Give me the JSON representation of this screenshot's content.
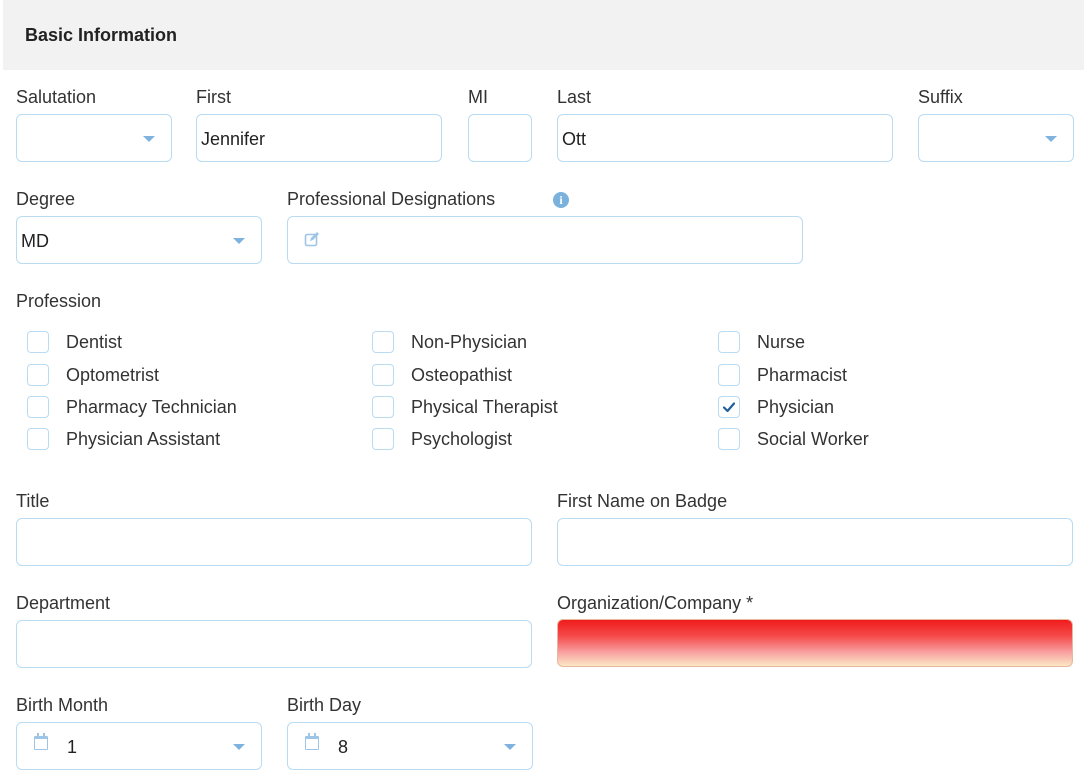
{
  "section": {
    "title": "Basic Information"
  },
  "name": {
    "salutation": {
      "label": "Salutation",
      "value": ""
    },
    "first": {
      "label": "First",
      "value": "Jennifer"
    },
    "mi": {
      "label": "MI",
      "value": ""
    },
    "last": {
      "label": "Last",
      "value": "Ott"
    },
    "suffix": {
      "label": "Suffix",
      "value": ""
    }
  },
  "degree": {
    "label": "Degree",
    "value": "MD"
  },
  "designations": {
    "label": "Professional Designations",
    "info_icon": "info-icon",
    "edit_icon": "edit-icon"
  },
  "profession": {
    "label": "Profession",
    "options": [
      {
        "label": "Dentist",
        "checked": false
      },
      {
        "label": "Non-Physician",
        "checked": false
      },
      {
        "label": "Nurse",
        "checked": false
      },
      {
        "label": "Optometrist",
        "checked": false
      },
      {
        "label": "Osteopathist",
        "checked": false
      },
      {
        "label": "Pharmacist",
        "checked": false
      },
      {
        "label": "Pharmacy Technician",
        "checked": false
      },
      {
        "label": "Physical Therapist",
        "checked": false
      },
      {
        "label": "Physician",
        "checked": true
      },
      {
        "label": "Physician Assistant",
        "checked": false
      },
      {
        "label": "Psychologist",
        "checked": false
      },
      {
        "label": "Social Worker",
        "checked": false
      }
    ]
  },
  "title_field": {
    "label": "Title",
    "value": ""
  },
  "badge_name": {
    "label": "First Name on Badge",
    "value": ""
  },
  "department": {
    "label": "Department",
    "value": ""
  },
  "organization": {
    "label": "Organization/Company *",
    "value": ""
  },
  "birth_month": {
    "label": "Birth Month",
    "value": "1"
  },
  "birth_day": {
    "label": "Birth Day",
    "value": "8"
  },
  "colors": {
    "accent": "#7fb2df",
    "border": "#b9dcf2",
    "check": "#1f5f9e",
    "error_top": "#f01c1c",
    "error_bottom": "#fbe7c4"
  }
}
